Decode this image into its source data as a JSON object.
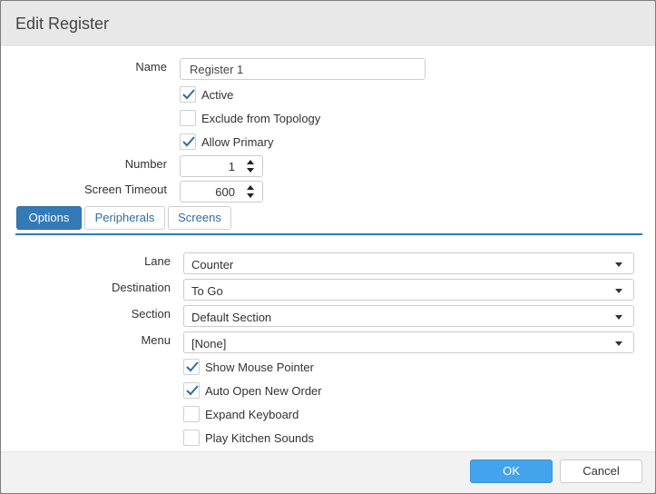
{
  "dialog": {
    "title": "Edit Register"
  },
  "form": {
    "name_label": "Name",
    "name_value": "Register 1",
    "active_label": "Active",
    "active_checked": true,
    "exclude_label": "Exclude from Topology",
    "exclude_checked": false,
    "allow_primary_label": "Allow Primary",
    "allow_primary_checked": true,
    "number_label": "Number",
    "number_value": "1",
    "timeout_label": "Screen Timeout",
    "timeout_value": "600"
  },
  "tabs": [
    {
      "label": "Options",
      "active": true
    },
    {
      "label": "Peripherals",
      "active": false
    },
    {
      "label": "Screens",
      "active": false
    }
  ],
  "options": {
    "lane_label": "Lane",
    "lane_value": "Counter",
    "destination_label": "Destination",
    "destination_value": "To Go",
    "section_label": "Section",
    "section_value": "Default Section",
    "menu_label": "Menu",
    "menu_value": "[None]",
    "show_mouse_label": "Show Mouse Pointer",
    "show_mouse_checked": true,
    "auto_open_label": "Auto Open New Order",
    "auto_open_checked": true,
    "expand_keyboard_label": "Expand Keyboard",
    "expand_keyboard_checked": false,
    "kitchen_sounds_label": "Play Kitchen Sounds",
    "kitchen_sounds_checked": false
  },
  "footer": {
    "ok_label": "OK",
    "cancel_label": "Cancel"
  },
  "colors": {
    "accent": "#337ab7",
    "ok_button": "#43a3ec",
    "checkmark": "#2e6da4",
    "titlebar": "#e8e8e8"
  },
  "icons": {
    "check": "checkmark-icon",
    "stepper": "spinner-arrows-icon",
    "dropdown": "caret-down-icon"
  }
}
